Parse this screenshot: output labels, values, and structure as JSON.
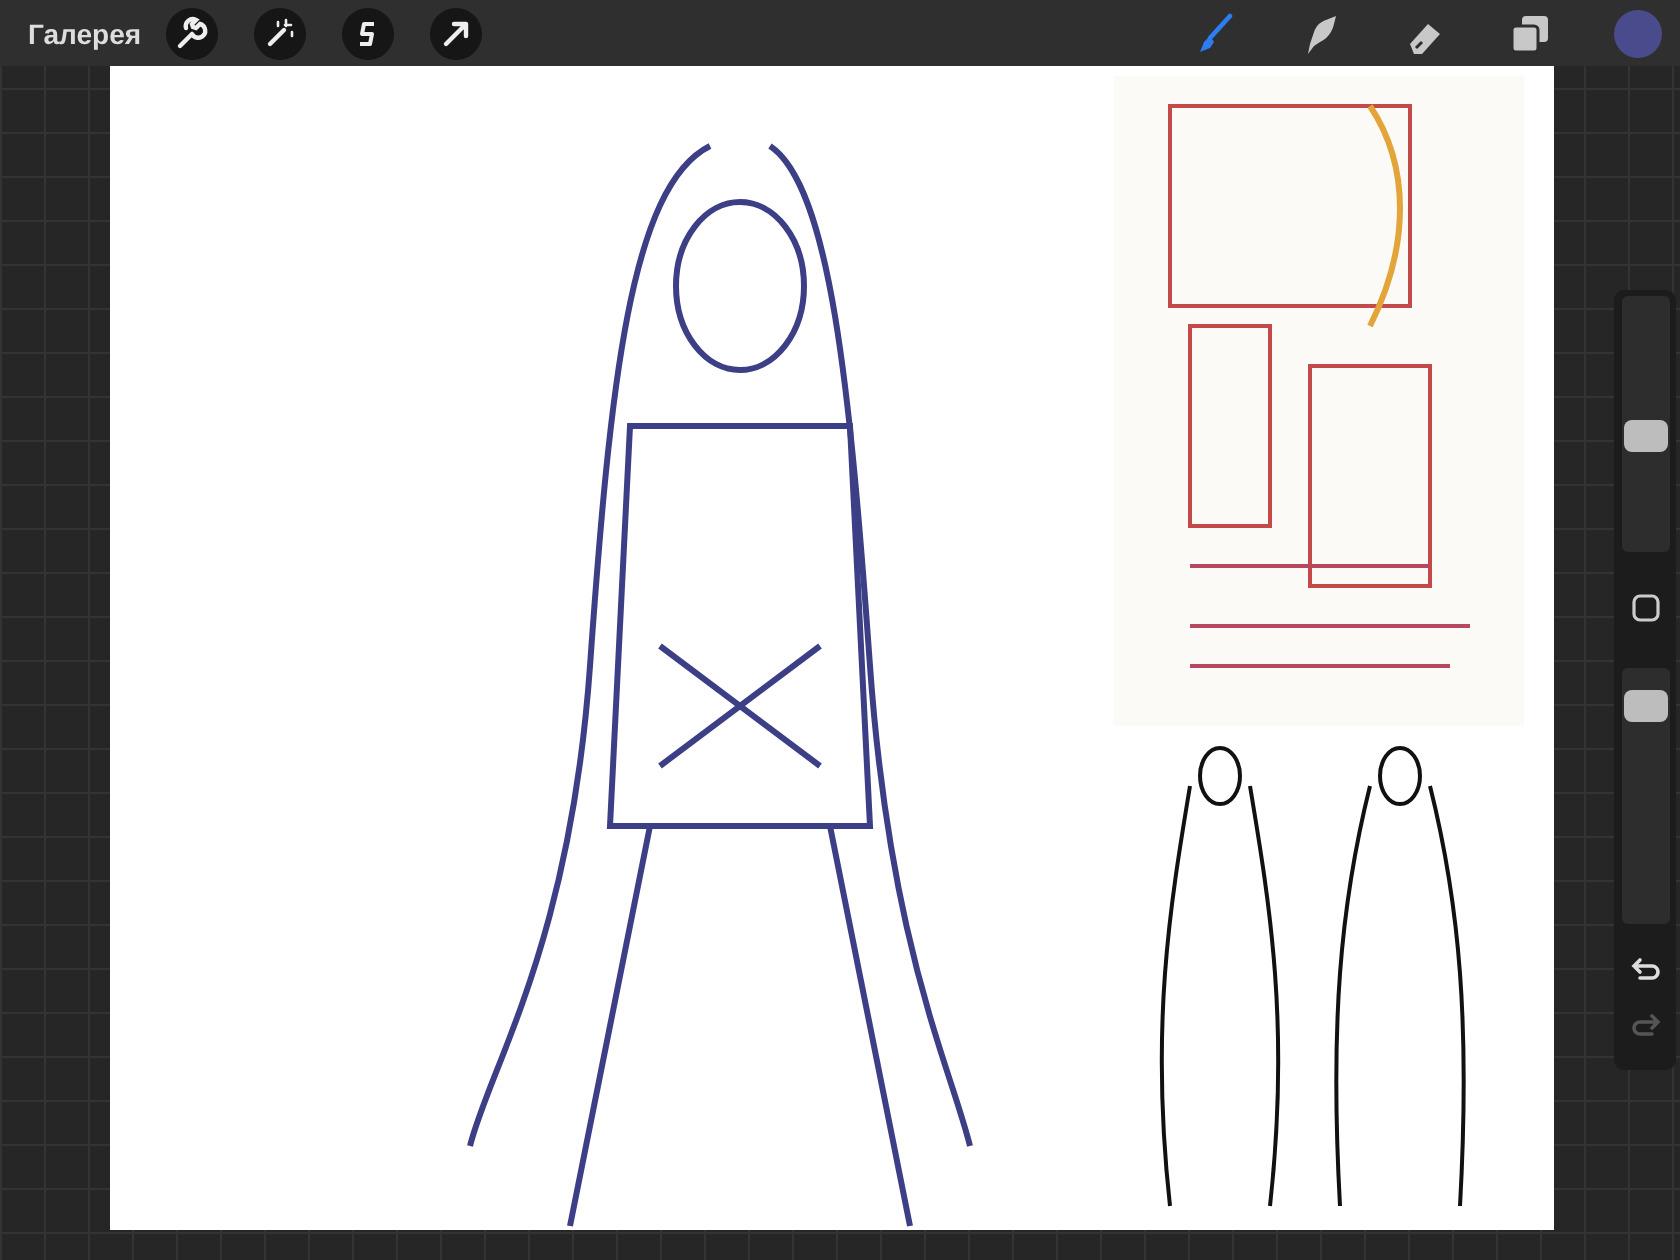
{
  "top_bar": {
    "gallery_label": "Галерея",
    "actions": [
      {
        "kind": "wrench"
      },
      {
        "kind": "wand"
      },
      {
        "kind": "selection"
      },
      {
        "kind": "move"
      }
    ],
    "tools": [
      {
        "kind": "brush",
        "selected": true
      },
      {
        "kind": "smudge",
        "selected": false
      },
      {
        "kind": "eraser",
        "selected": false
      },
      {
        "kind": "layers",
        "selected": false
      }
    ],
    "color": "#4a4b8c"
  },
  "sidebar": {
    "sliders": [
      {
        "level": 0.45
      },
      {
        "level": 0.9
      }
    ],
    "undo": {
      "disabled": false
    },
    "redo": {
      "disabled": true
    }
  }
}
